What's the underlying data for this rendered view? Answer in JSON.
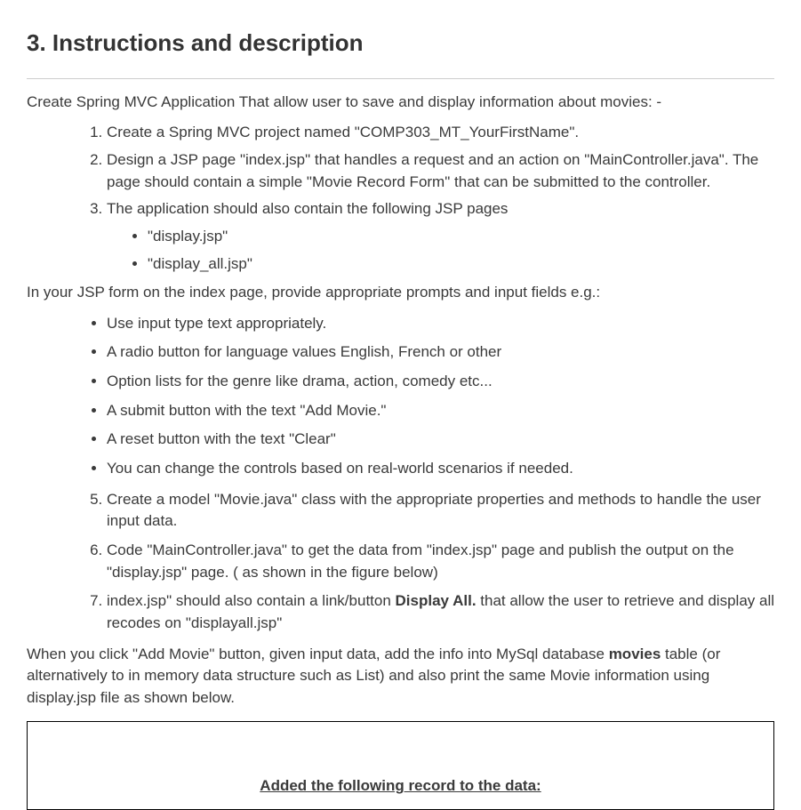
{
  "heading": "3. Instructions and description",
  "intro": "Create Spring MVC Application That allow user to save and display information about movies: -",
  "ol1": [
    "Create a Spring MVC project named \"COMP303_MT_YourFirstName\".",
    "Design a JSP page \"index.jsp\" that handles a request and an action on \"MainController.java\". The page should contain a simple \"Movie Record Form\" that can be submitted to the controller.",
    "The application should also contain the following JSP pages"
  ],
  "jspPages": [
    "\"display.jsp\"",
    "\"display_all.jsp\""
  ],
  "formIntro": "In your JSP form on the index page, provide appropriate prompts and input fields e.g.:",
  "formItems": [
    "Use input type text appropriately.",
    "A radio button for language values  English, French  or  other",
    "Option lists for the genre like drama, action, comedy etc...",
    "A submit button with the text \"Add Movie.\"",
    "A reset button with the text \"Clear\"",
    "You can change the controls based on real-world scenarios if needed."
  ],
  "ol2": {
    "item5": "Create a model \"Movie.java\" class with the appropriate properties and methods to handle the user input data.",
    "item6": "Code \"MainController.java\" to get the data from \"index.jsp\" page and publish the output on the \"display.jsp\" page. ( as shown in the figure below)",
    "item7_prefix": "index.jsp\" should also contain a link/button ",
    "item7_bold": "Display All.",
    "item7_suffix": " that allow the user to retrieve and display all recodes on \"displayall.jsp\""
  },
  "closing": {
    "p1": "When you click \"Add Movie\" button, given input data, add the info into MySql database ",
    "p1_bold": "movies",
    "p1_suffix": " table (or alternatively to in memory data structure such as List) and also print the same Movie information using display.jsp file as shown below."
  },
  "resultTitle": "Added the following record to the data:"
}
